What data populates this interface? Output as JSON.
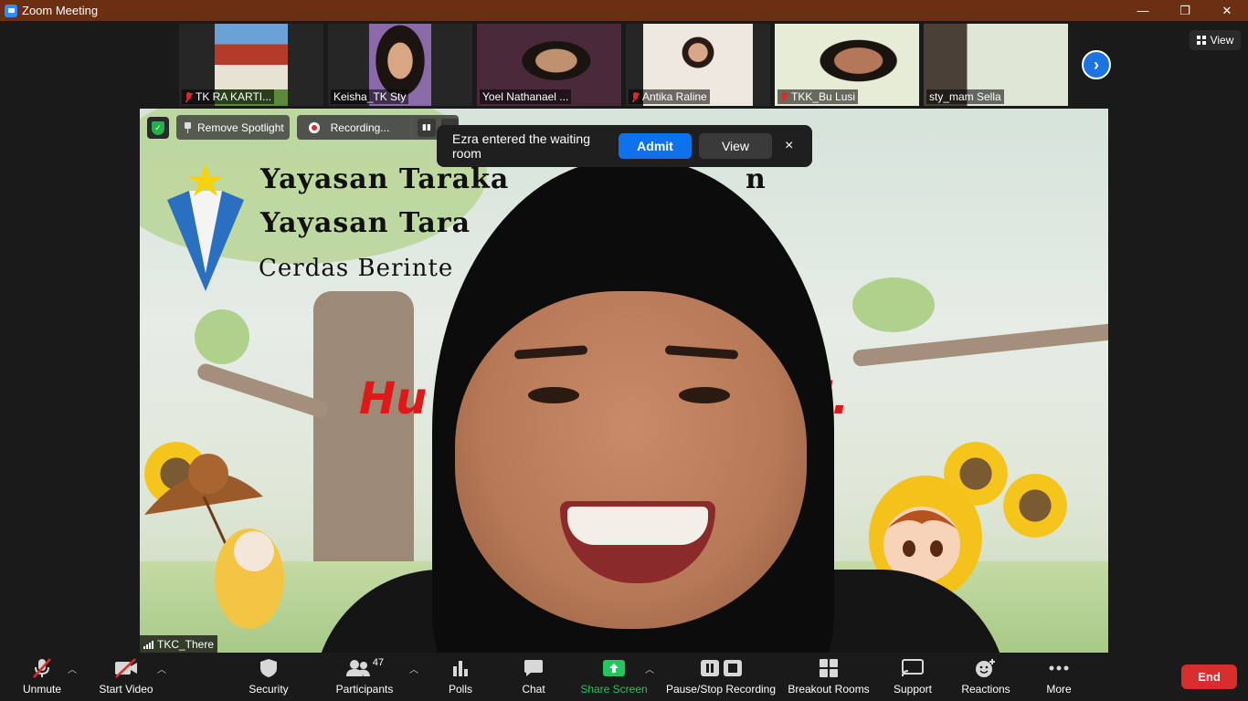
{
  "window": {
    "title": "Zoom Meeting",
    "minimize": "—",
    "restore": "❐",
    "close": "✕"
  },
  "filmstrip": {
    "view_label": "View",
    "participants": [
      {
        "name": "TK RA KARTI...",
        "muted": true
      },
      {
        "name": "Keisha_TK Sty",
        "muted": false
      },
      {
        "name": "Yoel Nathanael ...",
        "muted": false
      },
      {
        "name": "Antika Raline",
        "muted": true
      },
      {
        "name": "TKK_Bu Lusi",
        "muted": true
      },
      {
        "name": "sty_mam Sella",
        "muted": false
      }
    ]
  },
  "spotlight": {
    "remove_label": "Remove Spotlight"
  },
  "recording": {
    "status_label": "Recording...",
    "pause_glyph": "▮▮",
    "stop_glyph": "■"
  },
  "waiting_room": {
    "message": "Ezra entered the waiting room",
    "admit_label": "Admit",
    "view_label": "View",
    "close_glyph": "×"
  },
  "main_video": {
    "speaker_name": "TKC_There",
    "background_text": {
      "line1": "Yayasan Taraka",
      "line1_right": "n",
      "line2": "Yayasan Tara",
      "line3": "Cerdas Berinte",
      "deco_left": "Hu",
      "deco_right": "li."
    }
  },
  "toolbar": {
    "unmute": "Unmute",
    "start_video": "Start Video",
    "security": "Security",
    "participants": "Participants",
    "participant_count": "47",
    "polls": "Polls",
    "chat": "Chat",
    "share_screen": "Share Screen",
    "pause_stop_recording": "Pause/Stop Recording",
    "breakout_rooms": "Breakout Rooms",
    "support": "Support",
    "reactions": "Reactions",
    "more": "More",
    "end": "End"
  },
  "colors": {
    "titlebar": "#6b2f13",
    "accent": "#0e72ed",
    "end": "#d72d2d",
    "share": "#22c55e"
  }
}
